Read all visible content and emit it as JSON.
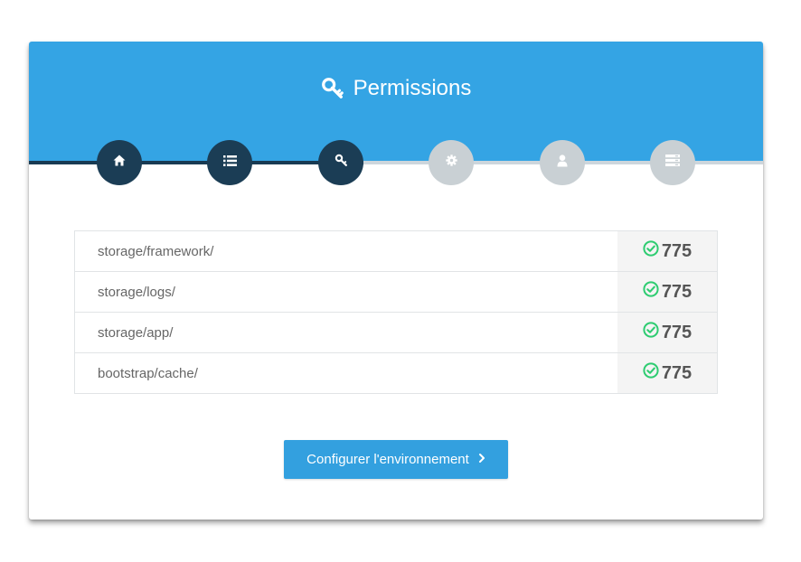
{
  "header": {
    "title": "Permissions",
    "icon": "key-icon",
    "background_color": "#34a4e4"
  },
  "steps": [
    {
      "name": "home",
      "icon": "home-icon",
      "state": "done"
    },
    {
      "name": "requirements",
      "icon": "list-icon",
      "state": "done"
    },
    {
      "name": "permissions",
      "icon": "key-icon",
      "state": "current"
    },
    {
      "name": "environment",
      "icon": "gear-icon",
      "state": "todo"
    },
    {
      "name": "admin",
      "icon": "user-icon",
      "state": "todo"
    },
    {
      "name": "finish",
      "icon": "server-icon",
      "state": "todo"
    }
  ],
  "permissions": [
    {
      "path": "storage/framework/",
      "value": "775",
      "status": "ok"
    },
    {
      "path": "storage/logs/",
      "value": "775",
      "status": "ok"
    },
    {
      "path": "storage/app/",
      "value": "775",
      "status": "ok"
    },
    {
      "path": "bootstrap/cache/",
      "value": "775",
      "status": "ok"
    }
  ],
  "actions": {
    "next_label": "Configurer l'environnement"
  },
  "colors": {
    "accent": "#34a4e4",
    "step_done": "#1b3d55",
    "step_todo": "#c9d0d4",
    "success": "#2ecc71"
  }
}
